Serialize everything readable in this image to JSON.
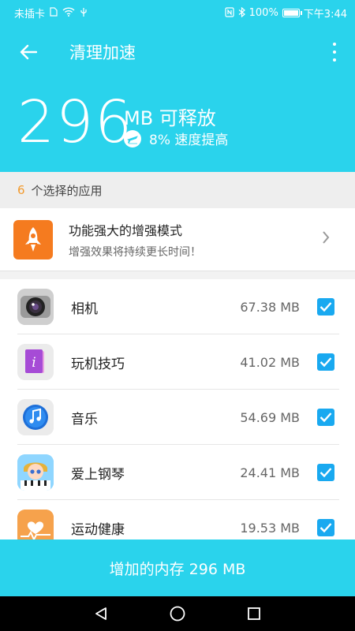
{
  "status_bar": {
    "carrier": "未插卡",
    "battery": "100%",
    "battery_level": 1.0,
    "time": "下午3:44"
  },
  "app_bar": {
    "title": "清理加速",
    "back_icon": "arrow-left-icon",
    "more_icon": "more-vertical-icon"
  },
  "summary": {
    "amount": "296",
    "unit_label": "MB 可释放",
    "speed_label": "8% 速度提高",
    "speed_icon": "airplane-icon"
  },
  "section": {
    "count": "6",
    "label": "个选择的应用"
  },
  "promo": {
    "title": "功能强大的增强模式",
    "subtitle": "增强效果将持续更长时间！",
    "icon": "rocket-icon"
  },
  "apps": [
    {
      "name": "相机",
      "size": "67.38 MB",
      "checked": true,
      "icon": "camera-icon"
    },
    {
      "name": "玩机技巧",
      "size": "41.02 MB",
      "checked": true,
      "icon": "tips-icon"
    },
    {
      "name": "音乐",
      "size": "54.69 MB",
      "checked": true,
      "icon": "music-icon"
    },
    {
      "name": "爱上钢琴",
      "size": "24.41 MB",
      "checked": true,
      "icon": "piano-game-icon"
    },
    {
      "name": "运动健康",
      "size": "19.53 MB",
      "checked": true,
      "icon": "health-icon"
    }
  ],
  "action": {
    "label": "增加的内存 296 MB"
  },
  "colors": {
    "accent": "#2ad3ec",
    "checkbox": "#19a9f0",
    "count": "#f29a2e",
    "promo_icon_bg": "#f57b1f"
  }
}
